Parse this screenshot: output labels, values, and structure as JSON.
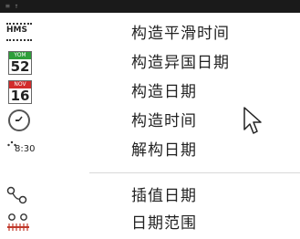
{
  "topbar": {
    "left_glyph": "≡ ↑"
  },
  "menu": {
    "items": [
      {
        "label": "构造平滑时间",
        "icon": "hms-icon"
      },
      {
        "label": "构造异国日期",
        "icon": "calendar-yom-52-icon",
        "cal_head": "YOM",
        "cal_num": "52",
        "cal_color": "#2e9e3a"
      },
      {
        "label": "构造日期",
        "icon": "calendar-nov-16-icon",
        "cal_head": "NOV",
        "cal_num": "16",
        "cal_color": "#d22b2b"
      },
      {
        "label": "构造时间",
        "icon": "clock-icon"
      },
      {
        "label": "解构日期",
        "icon": "deconstruct-date-icon",
        "icon_text": "8:30"
      },
      {
        "label": "插值日期",
        "icon": "interpolate-dates-icon"
      },
      {
        "label": "日期范围",
        "icon": "date-range-icon"
      }
    ],
    "hms_text": "HMS"
  }
}
